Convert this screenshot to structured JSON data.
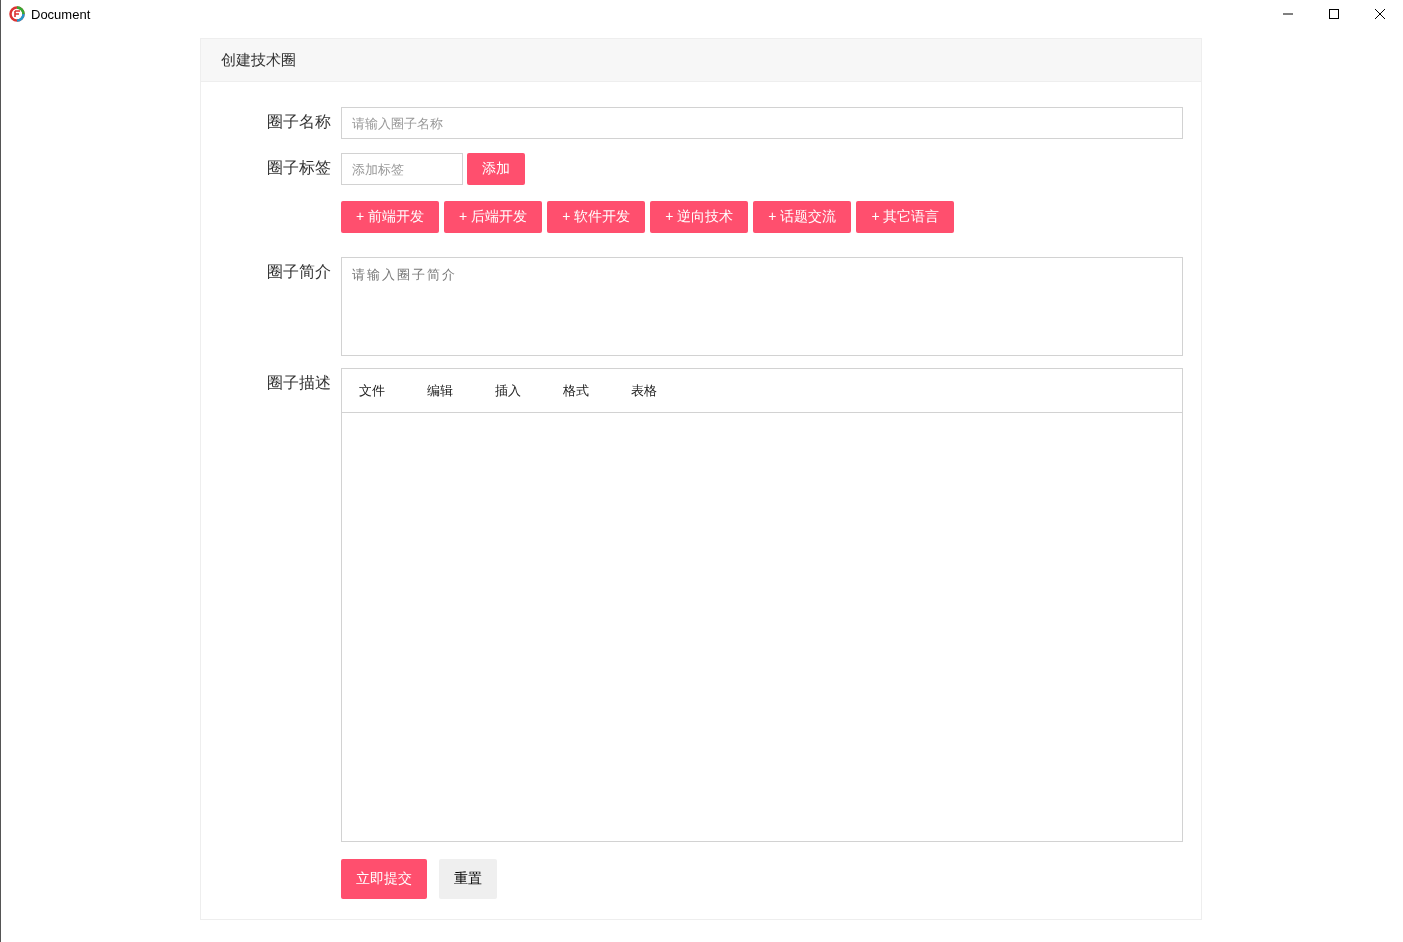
{
  "window": {
    "title": "Document"
  },
  "card": {
    "title": "创建技术圈"
  },
  "form": {
    "name": {
      "label": "圈子名称",
      "placeholder": "请输入圈子名称"
    },
    "tags": {
      "label": "圈子标签",
      "placeholder": "添加标签",
      "add_button": "添加",
      "suggestions": [
        "+ 前端开发",
        "+ 后端开发",
        "+ 软件开发",
        "+ 逆向技术",
        "+ 话题交流",
        "+ 其它语言"
      ]
    },
    "intro": {
      "label": "圈子简介",
      "placeholder": "请输入圈子简介"
    },
    "description": {
      "label": "圈子描述",
      "menu": [
        "文件",
        "编辑",
        "插入",
        "格式",
        "表格"
      ]
    },
    "buttons": [
      {
        "label": "立即提交",
        "kind": "primary"
      },
      {
        "label": "重置",
        "kind": "secondary"
      }
    ]
  }
}
